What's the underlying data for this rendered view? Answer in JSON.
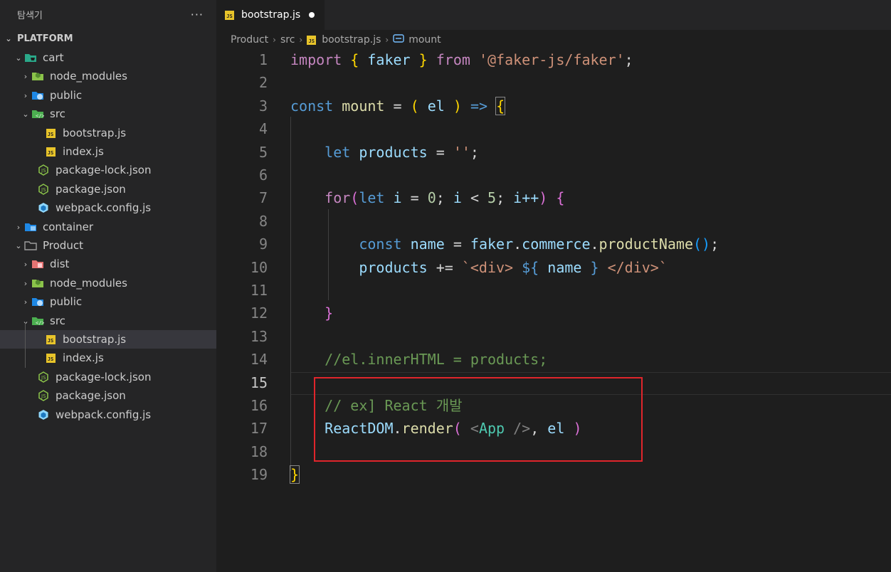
{
  "explorer": {
    "title": "탐색기",
    "more_icon": "more-actions-icon",
    "root_label": "PLATFORM",
    "items": [
      {
        "label": "cart",
        "icon": "folder-cart-icon",
        "expanded": true
      },
      {
        "label": "node_modules",
        "icon": "folder-node-icon"
      },
      {
        "label": "public",
        "icon": "folder-public-icon"
      },
      {
        "label": "src",
        "icon": "folder-src-icon",
        "expanded": true
      },
      {
        "label": "bootstrap.js",
        "icon": "js-file-icon"
      },
      {
        "label": "index.js",
        "icon": "js-file-icon"
      },
      {
        "label": "package-lock.json",
        "icon": "nodejs-icon"
      },
      {
        "label": "package.json",
        "icon": "nodejs-icon"
      },
      {
        "label": "webpack.config.js",
        "icon": "webpack-icon"
      },
      {
        "label": "container",
        "icon": "folder-container-icon"
      },
      {
        "label": "Product",
        "icon": "folder-icon",
        "expanded": true
      },
      {
        "label": "dist",
        "icon": "folder-dist-icon"
      },
      {
        "label": "node_modules",
        "icon": "folder-node-icon"
      },
      {
        "label": "public",
        "icon": "folder-public-icon"
      },
      {
        "label": "src",
        "icon": "folder-src-icon",
        "expanded": true
      },
      {
        "label": "bootstrap.js",
        "icon": "js-file-icon",
        "selected": true
      },
      {
        "label": "index.js",
        "icon": "js-file-icon"
      },
      {
        "label": "package-lock.json",
        "icon": "nodejs-icon"
      },
      {
        "label": "package.json",
        "icon": "nodejs-icon"
      },
      {
        "label": "webpack.config.js",
        "icon": "webpack-icon"
      }
    ]
  },
  "tab": {
    "label": "bootstrap.js",
    "modified": true
  },
  "breadcrumb": {
    "items": [
      "Product",
      "src",
      "bootstrap.js",
      "mount"
    ]
  },
  "editor": {
    "current_line": 15,
    "line_numbers": [
      "1",
      "2",
      "3",
      "4",
      "5",
      "6",
      "7",
      "8",
      "9",
      "10",
      "11",
      "12",
      "13",
      "14",
      "15",
      "16",
      "17",
      "18",
      "19"
    ],
    "lines": [
      "import { faker } from '@faker-js/faker';",
      "",
      "const mount = ( el ) => {",
      "",
      "    let products = '';",
      "",
      "    for(let i = 0; i < 5; i++) {",
      "",
      "        const name = faker.commerce.productName();",
      "        products += `<div> ${ name } </div>`",
      "",
      "    }",
      "",
      "    //el.innerHTML = products;",
      "",
      "    // ex] React 개발",
      "    ReactDOM.render( <App />, el )",
      "",
      "}"
    ],
    "tokens": {
      "l1": [
        "import",
        "{",
        "faker",
        "}",
        "from",
        "'@faker-js/faker'",
        ";"
      ],
      "l3": [
        "const",
        "mount",
        "=",
        "(",
        "el",
        ")",
        "=>",
        "{"
      ],
      "l5": [
        "let",
        "products",
        "=",
        "''",
        ";"
      ],
      "l7": [
        "for",
        "(",
        "let",
        "i",
        "=",
        "0",
        ";",
        "i",
        "<",
        "5",
        ";",
        "i++",
        ")",
        "{"
      ],
      "l9": [
        "const",
        "name",
        "=",
        "faker",
        ".",
        "commerce",
        ".",
        "productName",
        "()",
        ";"
      ],
      "l10": [
        "products",
        "+=",
        "`<div> ",
        "${",
        "name",
        "}",
        " </div>`"
      ],
      "l12": [
        "}"
      ],
      "l14": [
        "//el.innerHTML = products;"
      ],
      "l16": [
        "// ex] React 개발"
      ],
      "l17": [
        "ReactDOM",
        ".",
        "render",
        "(",
        "<",
        "App",
        "/>",
        ",",
        "el",
        ")"
      ],
      "l19": [
        "}"
      ]
    }
  },
  "annotation": {
    "color": "#e0252b"
  },
  "colors": {
    "editor_bg": "#1e1e1e",
    "sidebar_bg": "#252526",
    "selection_bg": "#37373d"
  }
}
